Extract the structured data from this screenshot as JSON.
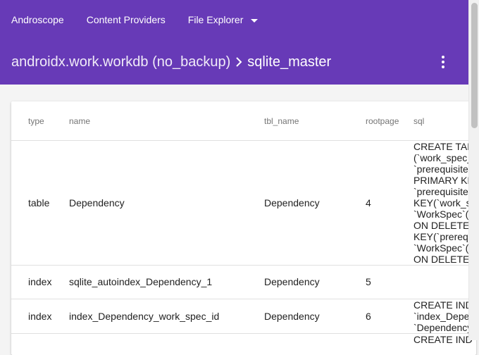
{
  "nav": {
    "brand": "Androscope",
    "content_providers": "Content Providers",
    "file_explorer": "File Explorer"
  },
  "breadcrumb": {
    "parent": "androidx.work.workdb (no_backup)",
    "current": "sqlite_master"
  },
  "table": {
    "headers": {
      "type": "type",
      "name": "name",
      "tbl_name": "tbl_name",
      "rootpage": "rootpage",
      "sql": "sql"
    },
    "rows": [
      {
        "type": "table",
        "name": "Dependency",
        "tbl_name": "Dependency",
        "rootpage": "4",
        "sql": "CREATE TAB\n(`work_spec_\n`prerequisite\nPRIMARY KE\n`prerequisite\nKEY(`work_s\n`WorkSpec`(`\nON DELETE C\nKEY(`prerequ\n`WorkSpec`(`\nON DELETE C"
      },
      {
        "type": "index",
        "name": "sqlite_autoindex_Dependency_1",
        "tbl_name": "Dependency",
        "rootpage": "5",
        "sql": ""
      },
      {
        "type": "index",
        "name": "index_Dependency_work_spec_id",
        "tbl_name": "Dependency",
        "rootpage": "6",
        "sql": "CREATE IND\n`index_Depe\n`Dependency"
      },
      {
        "type": "",
        "name": "",
        "tbl_name": "",
        "rootpage": "",
        "sql": "CREATE IND"
      }
    ]
  },
  "colors": {
    "app_bar": "#673ab7"
  }
}
